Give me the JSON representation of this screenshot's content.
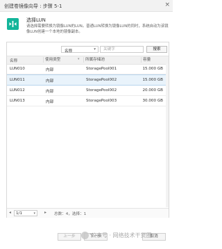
{
  "window": {
    "title": "创建卷镜像向导 : 步骤 5-1",
    "close_glyph": "×"
  },
  "step": {
    "title": "选择LUN",
    "description": "请选择需要转换为镜像LUN的LUN。普通LUN转换为镜像LUN的同时，系统自动为该镜像LUN创建一个本地的镜像副本。",
    "icon_color": "#13b59a"
  },
  "filter": {
    "field_selected": "名称",
    "search_placeholder": "关键字",
    "search_value": "",
    "search_button": "搜索"
  },
  "table": {
    "headers": [
      "名称",
      "使用类型",
      "所属存储池",
      "容量"
    ],
    "rows": [
      {
        "name": "LUN010",
        "usage": "内部",
        "pool": "StoragePool001",
        "capacity": "15.000 GB",
        "selected": false
      },
      {
        "name": "LUN011",
        "usage": "内部",
        "pool": "StoragePool002",
        "capacity": "15.000 GB",
        "selected": true
      },
      {
        "name": "LUN012",
        "usage": "内部",
        "pool": "StoragePool002",
        "capacity": "20.000 GB",
        "selected": false
      },
      {
        "name": "LUN013",
        "usage": "内部",
        "pool": "StoragePool003",
        "capacity": "30.000 GB",
        "selected": false
      }
    ],
    "selected_color": "#e9f3fb"
  },
  "pager": {
    "page_value": "1/1",
    "total": "总数：4，选择：1",
    "prev_glyph": "◂",
    "next_glyph": "▸"
  },
  "footer": {
    "prev_button": "上一步",
    "next_button": "下一步",
    "cancel_button": "取消"
  },
  "watermark": {
    "text": "公众号 · 网络技术干货圈"
  }
}
